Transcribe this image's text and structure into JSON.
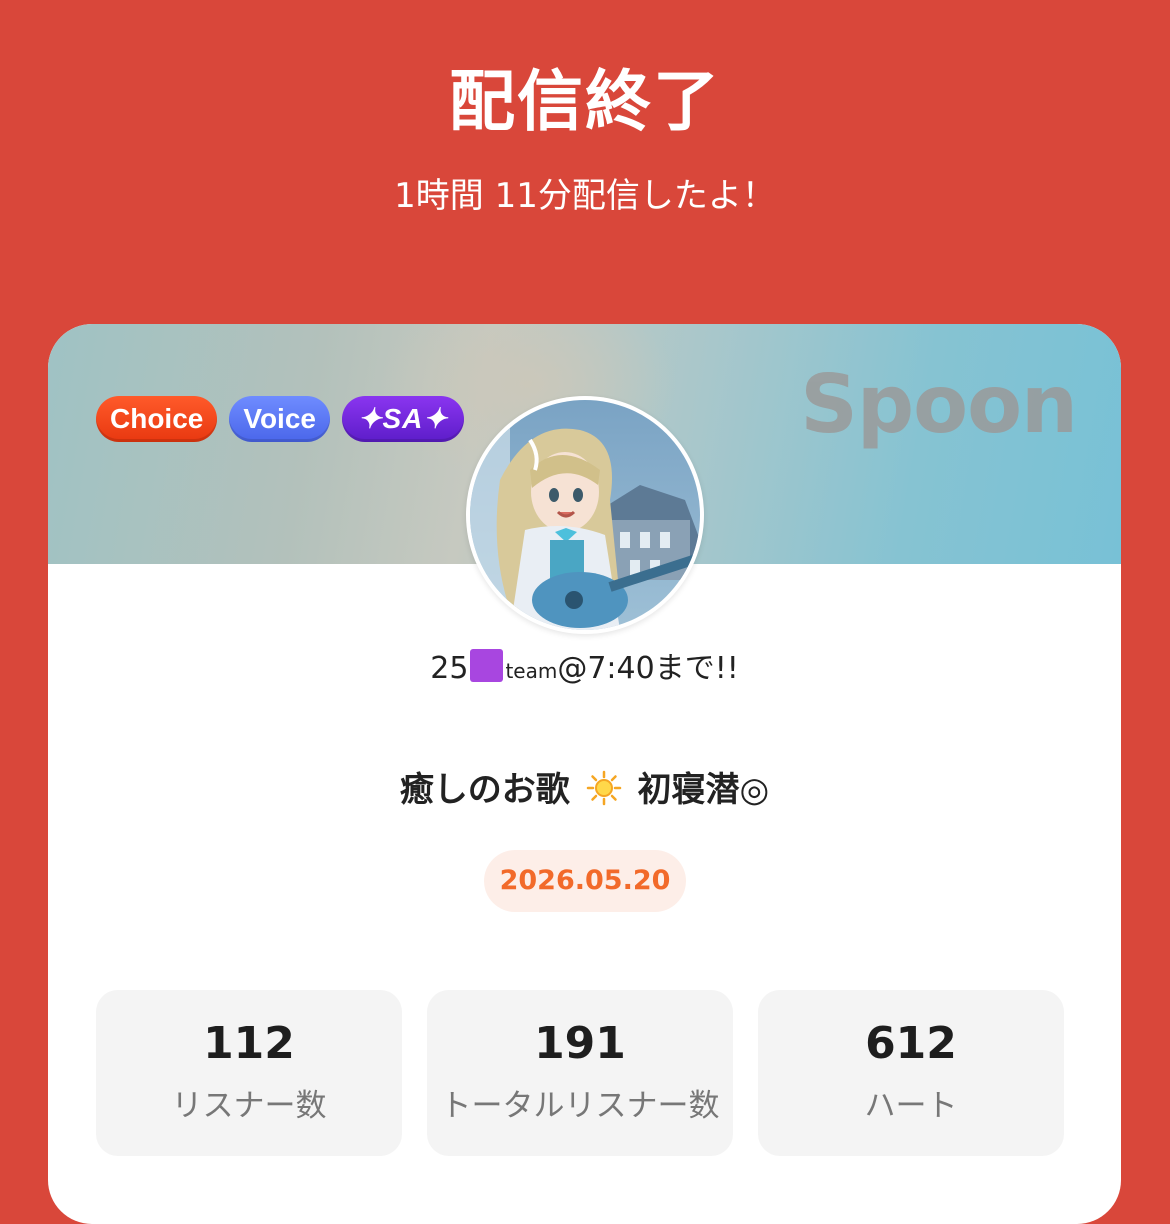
{
  "header": {
    "title": "配信終了",
    "subtitle": "1時間 11分配信したよ！"
  },
  "card": {
    "brand": "Spoon",
    "badges": [
      {
        "label": "Choice",
        "color": "#f04a1c"
      },
      {
        "label": "Voice",
        "color": "#5b78f6"
      },
      {
        "label": "✦SA✦",
        "color": "#7428dd"
      }
    ],
    "user": {
      "name_prefix": "25",
      "name_small": "team",
      "name_suffix": "@7:40まで!!",
      "square_color": "#a846e0",
      "avatar_icon": "anime-girl-guitar-avatar"
    },
    "live_title": {
      "before": "癒しのお歌",
      "icon": "sun-icon",
      "after": "初寝潜◎"
    },
    "date": "2026.05.20",
    "stats": [
      {
        "value": "112",
        "label": "リスナー数"
      },
      {
        "value": "191",
        "label": "トータルリスナー数"
      },
      {
        "value": "612",
        "label": "ハート"
      }
    ]
  },
  "colors": {
    "background": "#d9473a",
    "date_text": "#f26a2a",
    "date_pill": "#fdeee8"
  }
}
